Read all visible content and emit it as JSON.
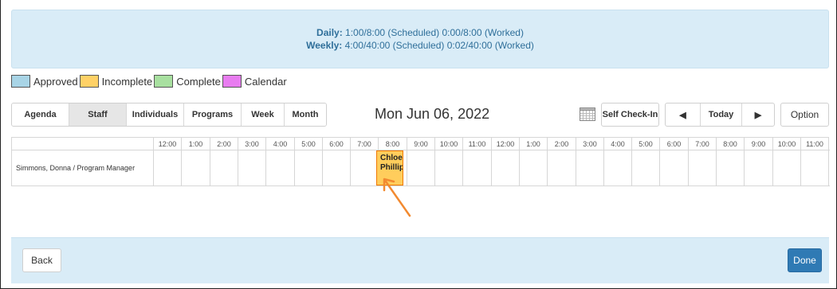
{
  "summary": {
    "daily_label": "Daily:",
    "daily_value": " 1:00/8:00 (Scheduled) 0:00/8:00 (Worked)",
    "weekly_label": "Weekly:",
    "weekly_value": " 4:00/40:00 (Scheduled) 0:02/40:00 (Worked)"
  },
  "legend": [
    {
      "label": "Approved",
      "color": "#a8d4e6"
    },
    {
      "label": "Incomplete",
      "color": "#ffd166"
    },
    {
      "label": "Complete",
      "color": "#a8e0a0"
    },
    {
      "label": "Calendar",
      "color": "#e87cf0"
    }
  ],
  "views": [
    "Agenda",
    "Staff",
    "Individuals",
    "Programs",
    "Week",
    "Month"
  ],
  "active_view": "Staff",
  "date_title": "Mon Jun 06, 2022",
  "toolbar": {
    "self_checkin": "Self Check-In",
    "prev": "◀",
    "today": "Today",
    "next": "▶",
    "option": "Option"
  },
  "grid": {
    "hours": [
      "12:00",
      "1:00",
      "2:00",
      "3:00",
      "4:00",
      "5:00",
      "6:00",
      "7:00",
      "8:00",
      "9:00",
      "10:00",
      "11:00",
      "12:00",
      "1:00",
      "2:00",
      "3:00",
      "4:00",
      "5:00",
      "6:00",
      "7:00",
      "8:00",
      "9:00",
      "10:00",
      "11:00"
    ],
    "rows": [
      {
        "name": "Simmons, Donna / Program Manager"
      }
    ],
    "event": {
      "line1": "Chloe",
      "line2": "Phillip",
      "color": "#ffcd5c",
      "border": "#f07800"
    }
  },
  "footer": {
    "back": "Back",
    "done": "Done"
  }
}
